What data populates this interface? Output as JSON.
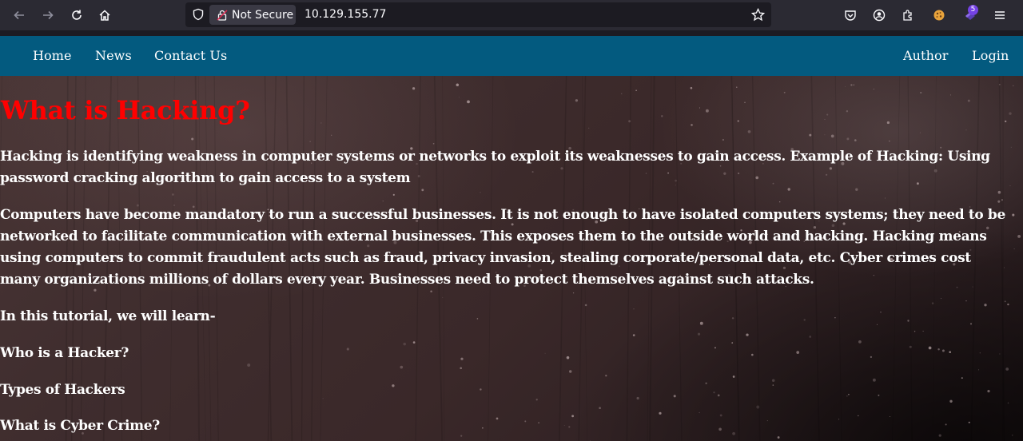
{
  "browser": {
    "url": "10.129.155.77",
    "security_label": "Not Secure",
    "extension_badge": "5"
  },
  "nav": {
    "left": [
      "Home",
      "News",
      "Contact Us"
    ],
    "right": [
      "Author",
      "Login"
    ]
  },
  "article": {
    "heading": "What is Hacking?",
    "paragraphs": [
      "Hacking is identifying weakness in computer systems or networks to exploit its weaknesses to gain access. Example of Hacking: Using password cracking algorithm to gain access to a system",
      "Computers have become mandatory to run a successful businesses. It is not enough to have isolated computers systems; they need to be networked to facilitate communication with external businesses. This exposes them to the outside world and hacking. Hacking means using computers to commit fraudulent acts such as fraud, privacy invasion, stealing corporate/personal data, etc. Cyber crimes cost many organizations millions of dollars every year. Businesses need to protect themselves against such attacks.",
      "In this tutorial, we will learn-",
      "Who is a Hacker?",
      "Types of Hackers",
      "What is Cyber Crime?"
    ]
  },
  "colors": {
    "navbar": "#035a7f",
    "heading": "#ff0000",
    "chrome": "#2b2a33"
  }
}
